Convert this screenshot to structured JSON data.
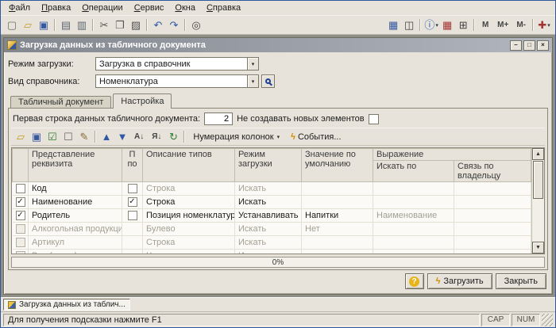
{
  "menu": {
    "items": [
      "Файл",
      "Правка",
      "Операции",
      "Сервис",
      "Окна",
      "Справка"
    ]
  },
  "icons": {
    "caret": "▾",
    "combo_arrow": "▾",
    "scroll_up": "▲",
    "scroll_down": "▼"
  },
  "toolbars": {
    "main": [
      {
        "name": "new-file-icon",
        "glyph": "▢",
        "color": "#6b6b6b"
      },
      {
        "name": "open-folder-icon",
        "glyph": "▱",
        "color": "#c49a1f"
      },
      {
        "name": "save-icon",
        "glyph": "▣",
        "color": "#35589f"
      },
      {
        "sep": true
      },
      {
        "name": "print-icon",
        "glyph": "▤",
        "color": "#5c6670"
      },
      {
        "name": "print-preview-icon",
        "glyph": "▥",
        "color": "#5c6670"
      },
      {
        "sep": true
      },
      {
        "name": "cut-icon",
        "glyph": "✂",
        "color": "#555555"
      },
      {
        "name": "copy-icon",
        "glyph": "❐",
        "color": "#555555"
      },
      {
        "name": "paste-icon",
        "glyph": "▨",
        "color": "#555555"
      },
      {
        "sep": true
      },
      {
        "name": "undo-icon",
        "glyph": "↶",
        "color": "#2f58a8"
      },
      {
        "name": "redo-icon",
        "glyph": "↷",
        "color": "#2f58a8"
      },
      {
        "sep": true
      },
      {
        "name": "find-icon",
        "glyph": "◎",
        "color": "#444444"
      },
      {
        "spacer": true
      },
      {
        "name": "table-document-icon",
        "glyph": "▦",
        "color": "#35589f"
      },
      {
        "name": "window-split-icon",
        "glyph": "◫",
        "color": "#444444"
      },
      {
        "sep": true
      },
      {
        "name": "info-icon",
        "glyph": "ⓘ",
        "color": "#1c56b0",
        "caret": true
      },
      {
        "name": "calendar-icon",
        "glyph": "▦",
        "color": "#a33333"
      },
      {
        "name": "calculator-icon",
        "glyph": "⊞",
        "color": "#444444"
      },
      {
        "sep": true
      },
      {
        "name": "memory-button",
        "glyph": "M",
        "text": true
      },
      {
        "name": "memory-plus-button",
        "glyph": "M+",
        "text": true
      },
      {
        "name": "memory-minus-button",
        "glyph": "M-",
        "text": true
      },
      {
        "sep": true
      },
      {
        "name": "service-icon",
        "glyph": "✚",
        "color": "#a33333",
        "caret": true
      }
    ],
    "dialog": [
      {
        "name": "open-file-icon",
        "glyph": "▱",
        "color": "#c49a1f"
      },
      {
        "name": "save-settings-icon",
        "glyph": "▣",
        "color": "#35589f"
      },
      {
        "name": "check-all-icon",
        "glyph": "☑",
        "color": "#2e7d32"
      },
      {
        "name": "uncheck-all-icon",
        "glyph": "☐",
        "color": "#666666"
      },
      {
        "name": "edit-icon",
        "glyph": "✎",
        "color": "#8a6d3b"
      },
      {
        "sep": true
      },
      {
        "name": "move-up-icon",
        "glyph": "▲",
        "color": "#2f58a8"
      },
      {
        "name": "move-down-icon",
        "glyph": "▼",
        "color": "#2f58a8"
      },
      {
        "name": "sort-asc-icon",
        "glyph": "А↓",
        "text": true
      },
      {
        "name": "sort-desc-icon",
        "glyph": "Я↓",
        "text": true
      },
      {
        "name": "refresh-icon",
        "glyph": "↻",
        "color": "#2e7d32"
      },
      {
        "sep": true
      }
    ],
    "numbering_button": "Нумерация колонок",
    "events_button": "События...",
    "events_icon_glyph": "ϟ"
  },
  "dialog": {
    "title": "Загрузка данных из табличного документа",
    "window_controls": {
      "minimize": "–",
      "maximize": "□",
      "close": "×"
    },
    "mode_label": "Режим загрузки:",
    "mode_value": "Загрузка в справочник",
    "catalog_label": "Вид справочника:",
    "catalog_value": "Номенклатура",
    "tabs": [
      {
        "label": "Табличный документ"
      },
      {
        "label": "Настройка"
      }
    ],
    "first_row_label": "Первая строка данных табличного документа:",
    "first_row_value": "2",
    "no_new_elements_label": "Не создавать новых элементов",
    "no_new_elements_checked": "",
    "progress_text": "0%",
    "help_glyph": "?",
    "load_icon_glyph": "ϟ",
    "load_button": "Загрузить",
    "close_button": "Закрыть"
  },
  "table": {
    "headers": {
      "attribute": "Представление реквизита",
      "search": "П по",
      "types": "Описание типов",
      "mode": "Режим загрузки",
      "default": "Значение по умолчанию",
      "expression": "Выражение",
      "search_by": "Искать по",
      "owner_link": "Связь по владельцу"
    },
    "rows": [
      {
        "mark": "",
        "name": "Код",
        "search": "",
        "type": "Строка",
        "mode": "Искать",
        "default": "",
        "search_by": "",
        "owner": "",
        "disabled": false,
        "muted": [
          "type",
          "mode"
        ]
      },
      {
        "mark": "✓",
        "name": "Наименование",
        "search": "✓",
        "type": "Строка",
        "mode": "Искать",
        "default": "",
        "search_by": "",
        "owner": "",
        "disabled": false,
        "muted": []
      },
      {
        "mark": "✓",
        "name": "Родитель",
        "search": "",
        "type": "Позиция номенклатуры",
        "mode": "Устанавливать",
        "default": "Напитки",
        "search_by": "Наименование",
        "owner": "",
        "disabled": false,
        "muted": [
          "search_by"
        ]
      },
      {
        "mark": "",
        "name": "Алкогольная продукция",
        "search": null,
        "type": "Булево",
        "mode": "Искать",
        "default": "Нет",
        "search_by": "",
        "owner": "",
        "disabled": true,
        "muted": []
      },
      {
        "mark": "",
        "name": "Артикул",
        "search": null,
        "type": "Строка",
        "mode": "Искать",
        "default": "",
        "search_by": "",
        "owner": "",
        "disabled": true,
        "muted": []
      },
      {
        "mark": "",
        "name": "Вес (нетто)",
        "search": null,
        "type": "Число",
        "mode": "Искать",
        "default": "",
        "search_by": "",
        "owner": "",
        "disabled": true,
        "muted": []
      }
    ]
  },
  "taskbar": {
    "item": "Загрузка данных из таблич..."
  },
  "statusbar": {
    "hint": "Для получения подсказки нажмите F1",
    "cap": "CAP",
    "num": "NUM"
  }
}
